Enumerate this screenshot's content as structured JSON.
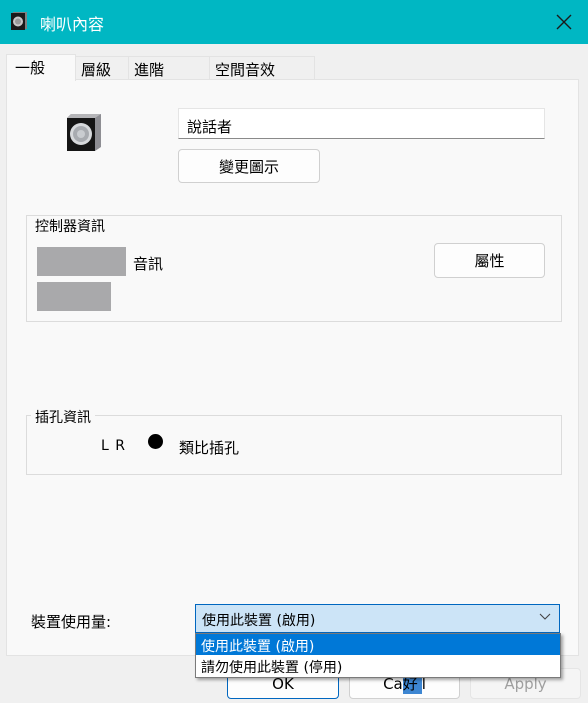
{
  "window": {
    "title": "喇叭內容",
    "close_icon": "close-icon",
    "title_bar_color": "#00b7c3"
  },
  "tabs": [
    {
      "label": "一般",
      "active": true
    },
    {
      "label": "層級",
      "active": false
    },
    {
      "label": "進階",
      "active": false
    },
    {
      "label": "空間音效",
      "active": false
    }
  ],
  "general": {
    "device_icon": "speaker-icon",
    "name_value": "說話者",
    "change_icon_label": "變更圖示",
    "controller": {
      "group_label": "控制器資訊",
      "controller_suffix": "音訊",
      "properties_label": "屬性"
    },
    "jack": {
      "group_label": "插孔資訊",
      "channels": "L R",
      "jack_type": "類比插孔"
    },
    "usage": {
      "label": "裝置使用量:",
      "selected": "使用此裝置 (啟用)",
      "options": [
        "使用此裝置 (啟用)",
        "請勿使用此裝置 (停用)"
      ],
      "highlighted_index": 0
    }
  },
  "footer": {
    "ok_label": "OK",
    "cancel_label_prefix": "Ca",
    "cancel_label_artifact": "好",
    "cancel_label_suffix": "l",
    "apply_label": "Apply"
  },
  "colors": {
    "accent": "#0078d7",
    "combo_bg": "#cce4f7",
    "panel_bg": "#f9f9f9",
    "window_bg": "#f0f0f0"
  }
}
